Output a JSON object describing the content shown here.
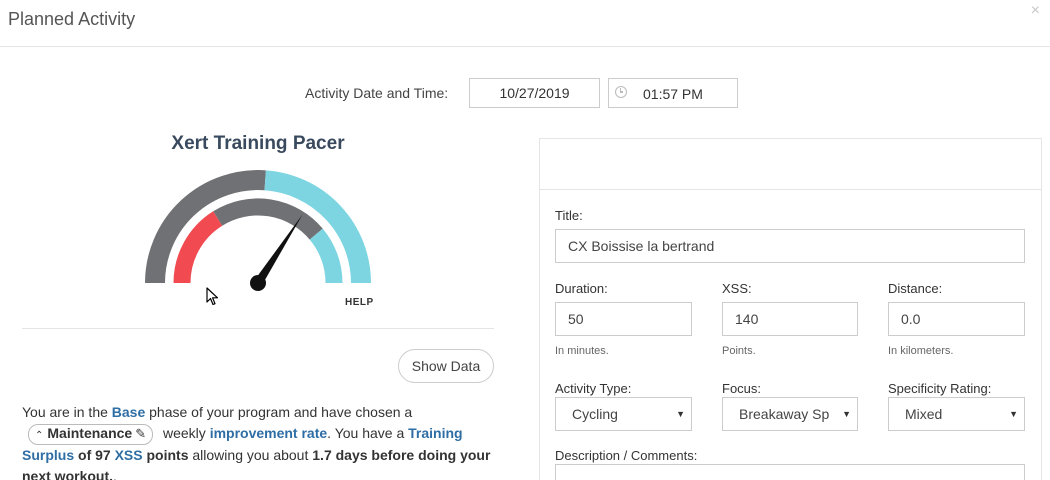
{
  "header": {
    "title": "Planned Activity",
    "close_label": "×"
  },
  "date_time": {
    "label": "Activity Date and Time:",
    "date": "10/27/2019",
    "time": "01:57 PM"
  },
  "pacer": {
    "title": "Xert Training Pacer",
    "help_label": "HELP",
    "show_data_label": "Show Data",
    "colors": {
      "red": "#f14a50",
      "gray": "#707174",
      "cyan": "#7cd5e1",
      "needle": "#111111"
    }
  },
  "info": {
    "p1": "You are in the ",
    "phase": "Base",
    "p2": " phase of your program and have chosen a",
    "rate_badge": "Maintenance",
    "p3": " weekly ",
    "improvement": "improvement rate",
    "p4": ". You have a ",
    "surplus": "Training Surplus",
    "p5": " of 97 ",
    "xss": "XSS",
    "p6": " points",
    "p7": " allowing you about ",
    "days": "1.7 days before doing your next workout.",
    "p8": "."
  },
  "form": {
    "title_label": "Title:",
    "title_value": "CX Boissise la bertrand",
    "duration_label": "Duration:",
    "duration_value": "50",
    "duration_hint": "In minutes.",
    "xss_label": "XSS:",
    "xss_value": "140",
    "xss_hint": "Points.",
    "distance_label": "Distance:",
    "distance_value": "0.0",
    "distance_hint": "In kilometers.",
    "activity_type_label": "Activity Type:",
    "activity_type_value": "Cycling",
    "focus_label": "Focus:",
    "focus_value": "Breakaway Sp",
    "specificity_label": "Specificity Rating:",
    "specificity_value": "Mixed",
    "description_label": "Description / Comments:"
  }
}
